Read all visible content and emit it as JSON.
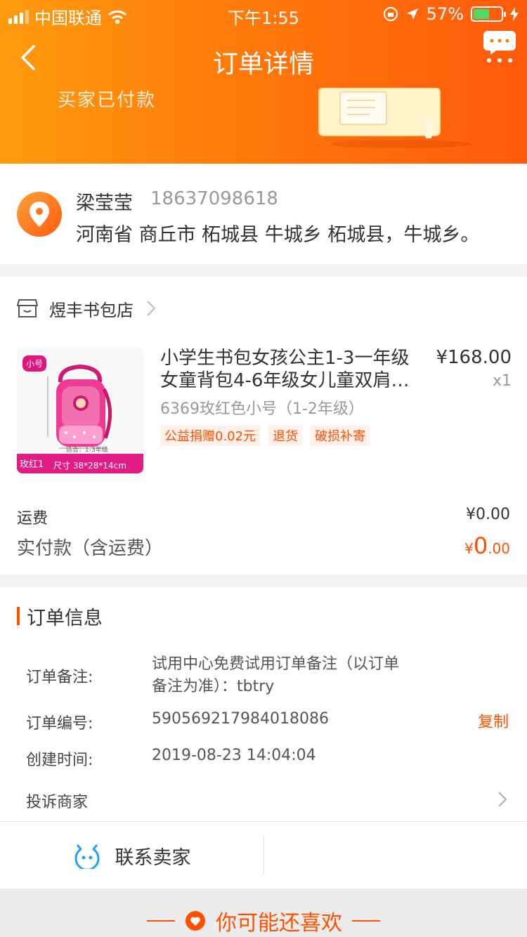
{
  "status_bar": {
    "carrier": "中国联通",
    "time": "下午1:55",
    "battery": "57%"
  },
  "nav": {
    "title": "订单详情"
  },
  "banner": {
    "status_text": "买家已付款"
  },
  "address": {
    "name": "梁莹莹",
    "phone": "18637098618",
    "full_address": "河南省 商丘市 柘城县 牛城乡 柘城县，牛城乡。"
  },
  "shop": {
    "name": "煜丰书包店"
  },
  "product": {
    "title": "小学生书包女孩公主1-3一年级女童背包4-6年级女儿童双肩…",
    "price": "¥168.00",
    "quantity": "x1",
    "sku": "6369玫红色小号（1-2年级）",
    "tags": [
      "公益捐赠0.02元",
      "退货",
      "破损补寄"
    ],
    "thumb": {
      "size_tag": "小号",
      "color_label": "玫红1",
      "dimension": "尺寸 38*28*14cm",
      "fit": "适合：1-3年级"
    }
  },
  "totals": {
    "shipping_label": "运费",
    "shipping_value": "¥0.00",
    "paid_label": "实付款（含运费）",
    "paid_currency": "¥",
    "paid_int": "0",
    "paid_dec": ".00"
  },
  "order_info": {
    "heading": "订单信息",
    "note_label": "订单备注:",
    "note_value_line1": "试用中心免费试用订单备注（以订单",
    "note_value_line2": "备注为准）：tbtry",
    "number_label": "订单编号:",
    "number_value": "590569217984018086",
    "copy_label": "复制",
    "created_label": "创建时间:",
    "created_value": "2019-08-23 14:04:04",
    "complain_label": "投诉商家"
  },
  "contact": {
    "label": "联系卖家"
  },
  "recommend": {
    "title": "你可能还喜欢"
  },
  "colors": {
    "accent": "#ff5000",
    "header_start": "#ff9b0e",
    "header_end": "#ff5a0c"
  }
}
